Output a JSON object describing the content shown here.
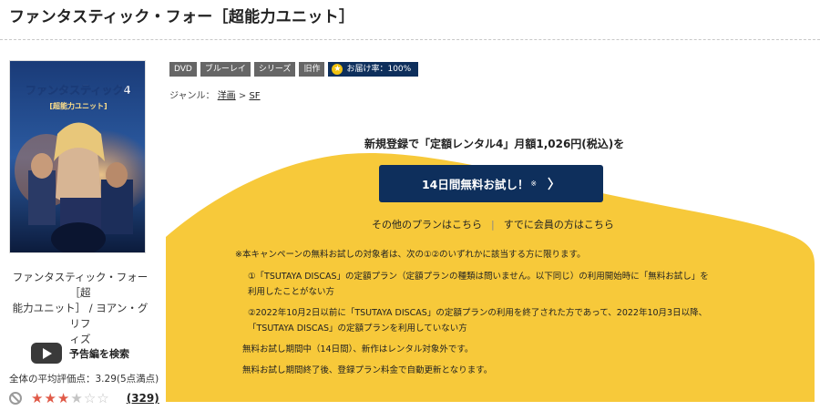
{
  "page": {
    "title": "ファンタスティック・フォー［超能力ユニット］"
  },
  "poster": {
    "alt": "ファンタスティック4 超能力ユニット poster",
    "art_title": "ファンタスティック4",
    "art_subtitle": "[超能力ユニット]"
  },
  "item": {
    "title_line1": "ファンタスティック・フォー［超",
    "title_line2": "能力ユニット］ / ヨアン・グリフ",
    "title_line3": "ィズ"
  },
  "trailer": {
    "label": "予告編を検索",
    "icon": "youtube-play-icon"
  },
  "rating": {
    "average_text": "全体の平均評価点：",
    "average_value": "3.29(5点満点)",
    "stars_filled": 3,
    "stars_total": 6,
    "review_count": "(329)",
    "icon": "no-entry-icon"
  },
  "tags": [
    "DVD",
    "ブルーレイ",
    "シリーズ",
    "旧作"
  ],
  "delivery": {
    "label": "お届け率：",
    "value": "100%",
    "icon": "star-badge-icon"
  },
  "genre": {
    "label": "ジャンル：",
    "parent": "洋画",
    "sep": ">",
    "child": "SF"
  },
  "promo": {
    "headline": "新規登録で「定額レンタル4」月額1,026円(税込)を",
    "cta_label": "14日間無料お試し！",
    "cta_mark": "※",
    "cta_chevron": "〉",
    "other_plans": "その他のプランはこちら",
    "separator": "|",
    "members": "すでに会員の方はこちら",
    "notes": {
      "n0": "※本キャンペーンの無料お試しの対象者は、次の①②のいずれかに該当する方に限ります。",
      "n1a": "①「TSUTAYA DISCAS」の定額プラン（定額プランの種類は問いません。以下同じ）の利用開始時に「無料お試し」を",
      "n1b": "利用したことがない方",
      "n2a": "②2022年10月2日以前に「TSUTAYA DISCAS」の定額プランの利用を終了された方であって、2022年10月3日以降、",
      "n2b": "「TSUTAYA DISCAS」の定額プランを利用していない方",
      "n3": "無料お試し期間中（14日間）、新作はレンタル対象外です。",
      "n4": "無料お試し期間終了後、登録プラン料金で自動更新となります。"
    }
  },
  "colors": {
    "navy": "#0e2f5c",
    "yellow": "#f7c93a",
    "star": "#e05a48",
    "tag_gray": "#666666"
  }
}
